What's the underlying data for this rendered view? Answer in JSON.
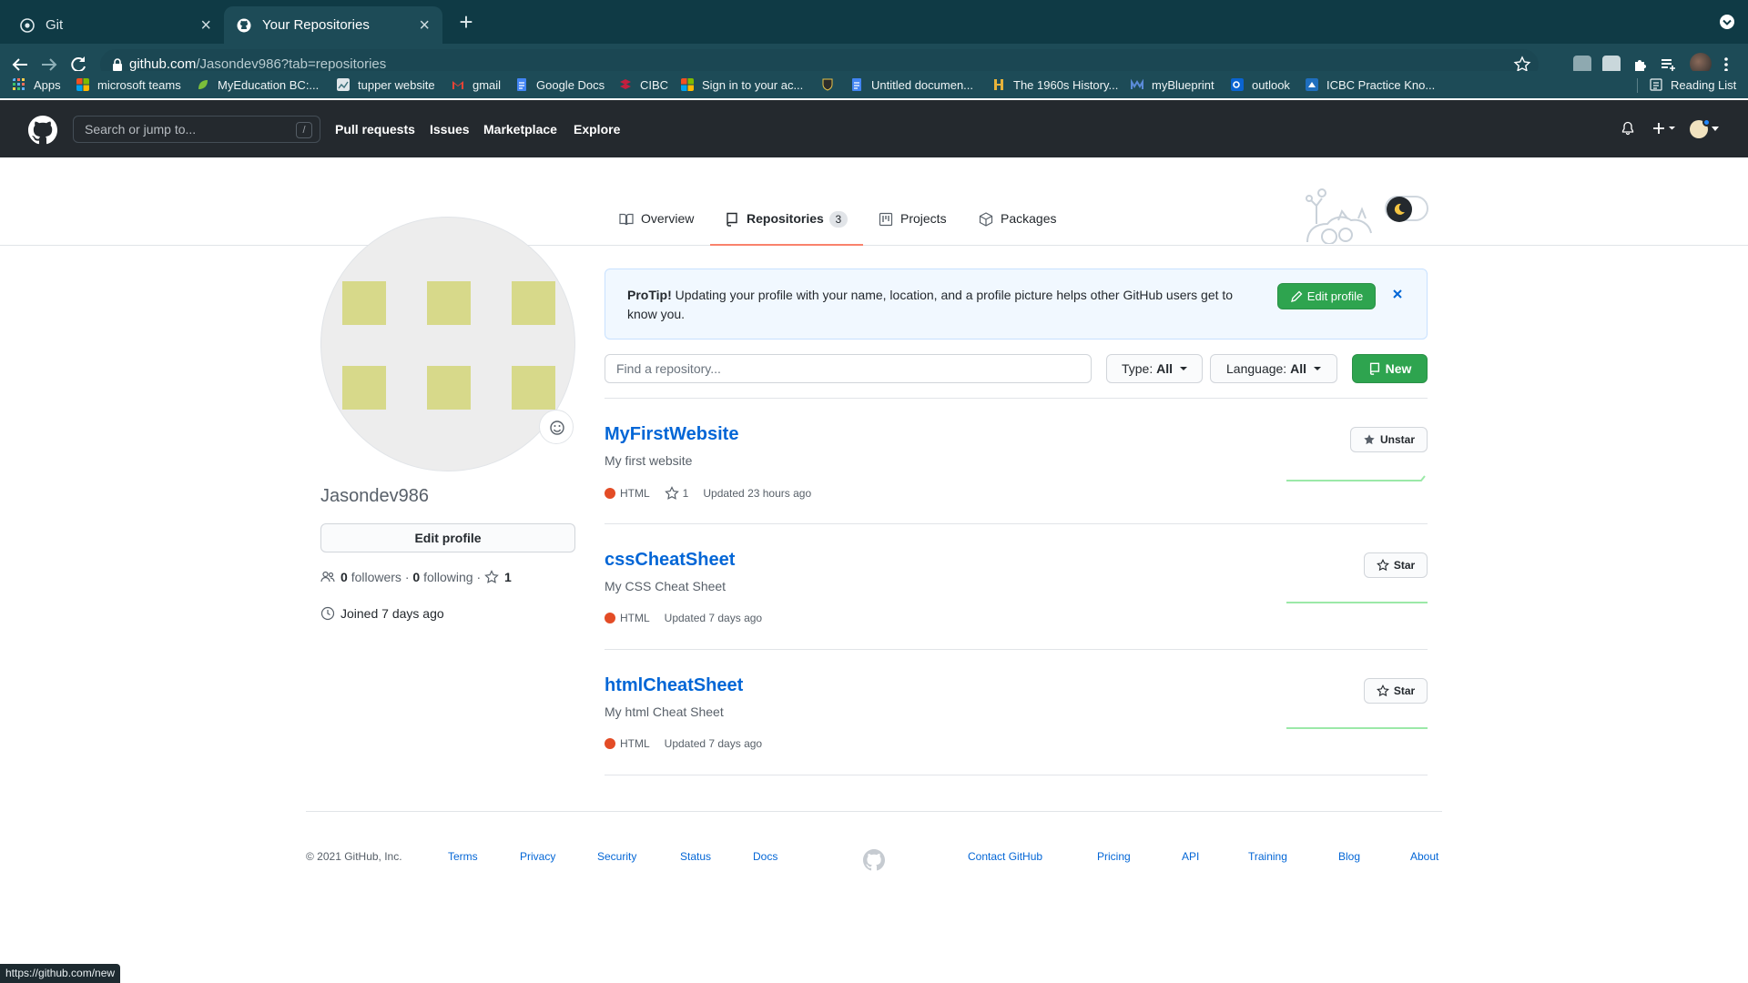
{
  "browser": {
    "tabs": [
      {
        "title": "Git",
        "icon": "chrome-favicon"
      },
      {
        "title": "Your Repositories",
        "icon": "github-favicon"
      }
    ],
    "url_host": "github.com",
    "url_path": "/Jasondev986?tab=repositories",
    "bookmarks": [
      {
        "label": "Apps",
        "color": "#ffffff"
      },
      {
        "label": "microsoft teams",
        "color": "#f25022"
      },
      {
        "label": "MyEducation BC:...",
        "color": "#7bbf3a"
      },
      {
        "label": "tupper website",
        "color": "#dfe6ea"
      },
      {
        "label": "gmail",
        "color": "#ea4335"
      },
      {
        "label": "Google Docs",
        "color": "#4285f4"
      },
      {
        "label": "CIBC",
        "color": "#c41f3e"
      },
      {
        "label": "Sign in to your ac...",
        "color": "#f25022"
      },
      {
        "label": "",
        "color": "#3b3b3b"
      },
      {
        "label": "Untitled documen...",
        "color": "#4285f4"
      },
      {
        "label": "The 1960s History...",
        "color": "#e7b33b"
      },
      {
        "label": "myBlueprint",
        "color": "#5a8bd8"
      },
      {
        "label": "outlook",
        "color": "#0a64d2"
      },
      {
        "label": "ICBC Practice Kno...",
        "color": "#1f6fbf"
      }
    ],
    "reading_list": "Reading List",
    "status_url": "https://github.com/new"
  },
  "github_header": {
    "search_placeholder": "Search or jump to...",
    "search_shortcut": "/",
    "nav": [
      "Pull requests",
      "Issues",
      "Marketplace",
      "Explore"
    ]
  },
  "profile_tabs": [
    {
      "label": "Overview",
      "icon": "book-icon"
    },
    {
      "label": "Repositories",
      "icon": "repo-icon",
      "count": "3",
      "selected": true
    },
    {
      "label": "Projects",
      "icon": "project-icon"
    },
    {
      "label": "Packages",
      "icon": "package-icon"
    }
  ],
  "sidebar": {
    "username": "Jasondev986",
    "edit_profile": "Edit profile",
    "followers_count": "0",
    "followers_label": "followers",
    "following_count": "0",
    "following_label": "following",
    "stars_count": "1",
    "joined": "Joined 7 days ago"
  },
  "protip": {
    "lead": "ProTip!",
    "text": "Updating your profile with your name, location, and a profile picture helps other GitHub users get to know you.",
    "button": "Edit profile"
  },
  "filters": {
    "search_placeholder": "Find a repository...",
    "type_label": "Type:",
    "type_value": "All",
    "language_label": "Language:",
    "language_value": "All",
    "new_button": "New"
  },
  "repos": [
    {
      "name": "MyFirstWebsite",
      "description": "My first website",
      "language": "HTML",
      "language_color": "#e34c26",
      "stars": "1",
      "updated": "Updated 23 hours ago",
      "star_button": "Unstar"
    },
    {
      "name": "cssCheatSheet",
      "description": "My CSS Cheat Sheet",
      "language": "HTML",
      "language_color": "#e34c26",
      "stars": "",
      "updated": "Updated 7 days ago",
      "star_button": "Star"
    },
    {
      "name": "htmlCheatSheet",
      "description": "My html Cheat Sheet",
      "language": "HTML",
      "language_color": "#e34c26",
      "stars": "",
      "updated": "Updated 7 days ago",
      "star_button": "Star"
    }
  ],
  "footer": {
    "copyright": "© 2021 GitHub, Inc.",
    "links_left": [
      "Terms",
      "Privacy",
      "Security",
      "Status",
      "Docs"
    ],
    "links_right": [
      "Contact GitHub",
      "Pricing",
      "API",
      "Training",
      "Blog",
      "About"
    ]
  },
  "colors": {
    "accent_link": "#0366d6",
    "primary_button": "#2ea44f",
    "selected_tab_underline": "#f9826c",
    "header_bg": "#24292e"
  }
}
